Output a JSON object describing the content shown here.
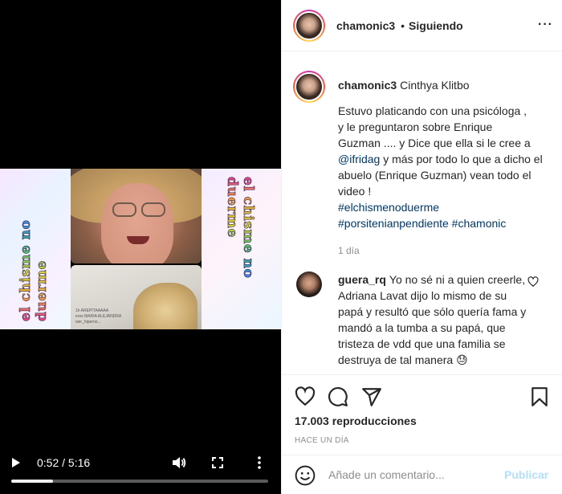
{
  "video": {
    "overlay_text_left": "el chisme no duerme",
    "overlay_text_right": "el chisme no duerme",
    "screen_overlay_lines": [
      "1h AREPITAAAAA",
      "eres MARIA ALEJANDRA",
      "wer_hiperno..."
    ],
    "time_current": "0:52",
    "time_separator": " / ",
    "time_total": "5:16",
    "progress": 0.164,
    "icons": {
      "play": "play-icon",
      "volume": "volume-icon",
      "fullscreen": "fullscreen-icon",
      "more": "more-vertical-icon"
    }
  },
  "post": {
    "author": "chamonic3",
    "separator": "•",
    "follow_status": "Siguiendo",
    "more": "···",
    "caption": {
      "username": "chamonic3",
      "mention_name": "Cinthya Klitbo",
      "text_lines": [
        "Estuvo platicando con una psicóloga ,",
        "y le preguntaron sobre Enrique",
        "Guzman .... y Dice que ella si le cree a"
      ],
      "mention": "@ifridag",
      "text_after_mention": " y más por todo lo que a dicho el abuelo (Enrique Guzman) vean todo el video !",
      "hashtag_1": "#elchismenoduerme",
      "hashtag_2": "#porsitenianpendiente",
      "hashtag_3": "#chamonic",
      "time": "1 día"
    },
    "comment": {
      "username": "guera_rq",
      "text": "Yo no sé ni a quien creerle, Adriana Lavat dijo lo mismo de su papá y resultó que sólo quería fama y mandó a la tumba a su papá, que tristeza de vdd que una familia se destruya de tal manera 😓"
    },
    "views_count": "17.003",
    "views_label": "reproducciones",
    "date_label": "HACE UN DÍA",
    "comment_placeholder": "Añade un comentario...",
    "publish_label": "Publicar"
  },
  "colors": {
    "text": "#262626",
    "secondary": "#8e8e8e",
    "link": "#00376b",
    "publish_disabled": "#b2dffc"
  }
}
